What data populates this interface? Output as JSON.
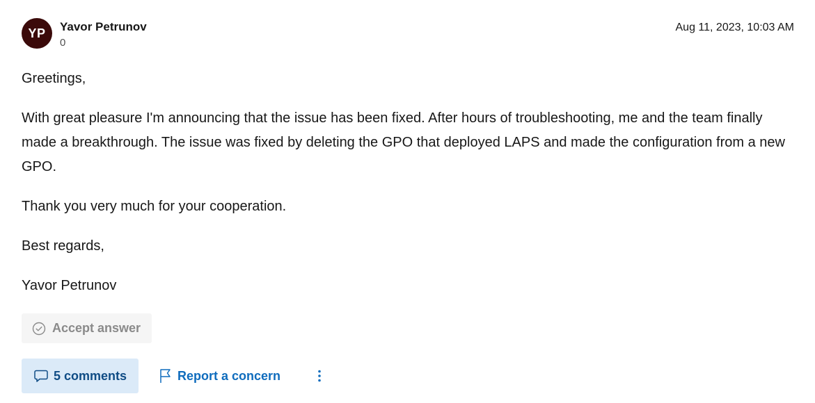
{
  "author": {
    "initials": "YP",
    "name": "Yavor Petrunov",
    "reputation": "0"
  },
  "post": {
    "date": "Aug 11, 2023, 10:03 AM",
    "paragraphs": [
      "Greetings,",
      "With great pleasure I'm announcing that the issue has been fixed. After hours of troubleshooting, me and the team finally made a breakthrough. The issue was fixed by deleting the GPO that deployed LAPS and made the configuration from a new GPO.",
      "Thank you very much for your cooperation.",
      "Best regards,",
      "Yavor Petrunov"
    ]
  },
  "actions": {
    "accept_label": "Accept answer",
    "comments_label": "5 comments",
    "report_label": "Report a concern"
  },
  "icons": {
    "accept": "check-circle-icon",
    "comments": "comment-icon",
    "report": "flag-icon",
    "more": "more-vertical-icon"
  },
  "colors": {
    "avatar_bg": "#3b0a0a",
    "link_blue": "#0f6cbd",
    "comments_bg": "#dbeaf8",
    "accept_bg": "#f5f5f5",
    "accept_text": "#8a8a8a"
  }
}
